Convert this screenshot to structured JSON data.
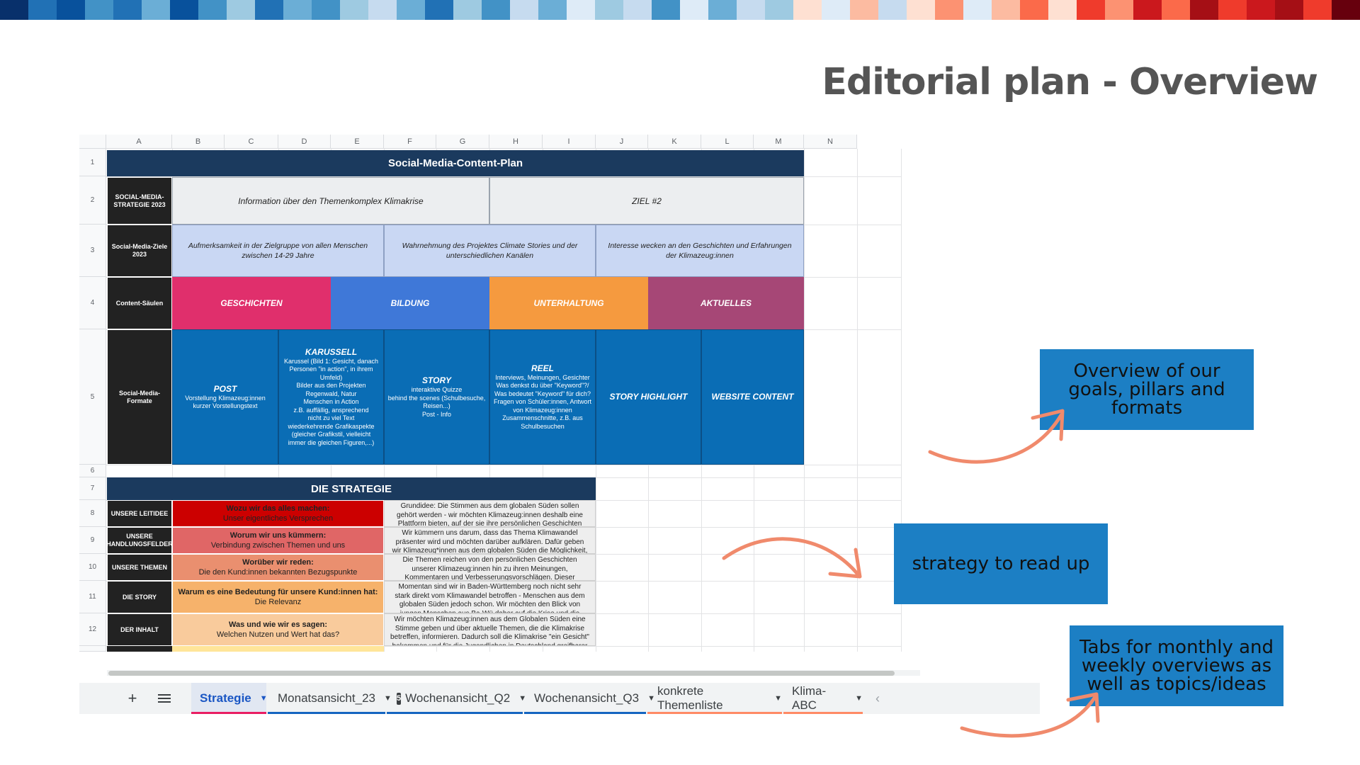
{
  "slide": {
    "title": "Editorial plan - Overview"
  },
  "stripe_colors": [
    "#08306b",
    "#2171b5",
    "#08519c",
    "#4292c6",
    "#2171b5",
    "#6baed6",
    "#08519c",
    "#4292c6",
    "#9ecae1",
    "#2171b5",
    "#6baed6",
    "#4292c6",
    "#9ecae1",
    "#c6dbef",
    "#6baed6",
    "#2171b5",
    "#9ecae1",
    "#4292c6",
    "#c6dbef",
    "#6baed6",
    "#deebf7",
    "#9ecae1",
    "#c6dbef",
    "#4292c6",
    "#deebf7",
    "#6baed6",
    "#c6dbef",
    "#9ecae1",
    "#fee0d2",
    "#deebf7",
    "#fcbba1",
    "#c6dbef",
    "#fee0d2",
    "#fc9272",
    "#deebf7",
    "#fcbba1",
    "#fb6a4a",
    "#fee0d2",
    "#ef3b2c",
    "#fc9272",
    "#cb181d",
    "#fb6a4a",
    "#a50f15",
    "#ef3b2c",
    "#cb181d",
    "#a50f15",
    "#ef3b2c",
    "#67000d"
  ],
  "sheet": {
    "columns": [
      "A",
      "B",
      "C",
      "D",
      "E",
      "F",
      "G",
      "H",
      "I",
      "J",
      "K",
      "L",
      "M",
      "N"
    ],
    "rows": [
      "1",
      "2",
      "3",
      "4",
      "5",
      "6",
      "7",
      "8",
      "9",
      "10",
      "11",
      "12"
    ],
    "header": "Social-Media-Content-Plan",
    "row2": {
      "label": "SOCIAL-MEDIA-STRATEGIE 2023",
      "goal1": "Information über den Themenkomplex Klimakrise",
      "goal2": "ZIEL #2"
    },
    "row3": {
      "label": "Social-Media-Ziele 2023",
      "z1": "Aufmerksamkeit in der Zielgruppe von allen Menschen zwischen 14-29 Jahre",
      "z2": "Wahrnehmung des Projektes Climate Stories und der unterschiedlichen Kanälen",
      "z3": "Interesse wecken an den Geschichten und Erfahrungen der Klimazeug:innen"
    },
    "row4": {
      "label": "Content-Säulen",
      "pillars": [
        {
          "label": "GESCHICHTEN",
          "color": "#e02f6c"
        },
        {
          "label": "BILDUNG",
          "color": "#3f78d8"
        },
        {
          "label": "UNTERHALTUNG",
          "color": "#f59a3f"
        },
        {
          "label": "AKTUELLES",
          "color": "#a64776"
        }
      ]
    },
    "row5": {
      "label": "Social-Media- Formate",
      "formats": [
        {
          "title": "POST",
          "desc": "Vorstellung Klimazeug:innen\nkurzer Vorstellungstext"
        },
        {
          "title": "KARUSSELL",
          "desc": "Karussel (Bild 1: Gesicht, danach Personen \"in action\", in ihrem Umfeld)\nBilder aus den Projekten\nRegenwald, Natur\nMenschen in Action\nz.B. auffällig, ansprechend\nnicht zu viel Text\nwiederkehrende Grafikaspekte (gleicher Grafikstil, vielleicht immer die gleichen Figuren,...)"
        },
        {
          "title": "STORY",
          "desc": "interaktive Quizze\nbehind the scenes (Schulbesuche, Reisen...)\nPost - Info"
        },
        {
          "title": "REEL",
          "desc": "Interviews, Meinungen, Gesichter\nWas denkst du über \"Keyword\"?/ Was bedeutet \"Keyword\" für dich?\nFragen von Schüler:innen, Antwort von Klimazeug:innen\nZusammenschnitte, z.B. aus Schulbesuchen"
        },
        {
          "title": "STORY HIGHLIGHT",
          "desc": ""
        },
        {
          "title": "WEBSITE CONTENT",
          "desc": ""
        }
      ]
    },
    "strategy_header": "DIE STRATEGIE",
    "strategy_rows": [
      {
        "label": "UNSERE LEITIDEE",
        "q": "Wozu wir das alles machen:",
        "a": "Unser eigentliches Versprechen",
        "color": "#cc0000",
        "text": "Grundidee: Die Stimmen aus dem globalen Süden sollen gehört werden - wir möchten Klimazeug:innen deshalb eine Plattform bieten, auf der sie ihre persönlichen Geschichten erzählen können."
      },
      {
        "label": "UNSERE HANDLUNGSFELDER",
        "q": "Worum wir uns kümmern:",
        "a": "Verbindung zwischen Themen und uns",
        "color": "#e06666",
        "text": "Wir kümmern uns darum, dass das Thema Klimawandel präsenter wird und möchten darüber aufklären. Dafür geben wir Klimazeug*innen aus dem globalen Süden die Möglichkeit, ihre Erfahrungen zu erzählen und aufzuklären. Somit können wir das wichtige"
      },
      {
        "label": "UNSERE THEMEN",
        "q": "Worüber wir reden:",
        "a": "Die den Kund:innen bekannten Bezugspunkte",
        "color": "#ea8f6f",
        "text": "Die Themen reichen von den persönlichen Geschichten unserer Klimazeug:innen hin zu ihren Meinungen, Kommentaren und Verbesserungsvorschlägen. Dieser persönliche Themenkomplex wird mit seriösen und informativen Inhalten zum Thema Klimawandel"
      },
      {
        "label": "DIE STORY",
        "q": "Warum es eine Bedeutung für unsere Kund:innen hat:",
        "a": "Die Relevanz",
        "color": "#f6b26b",
        "text": "Momentan sind wir in Baden-Württemberg noch nicht sehr stark direkt vom Klimawandel betroffen - Menschen aus dem globalen Süden jedoch schon. Wir möchten den Blick von jungen Menschen aus Ba-Wü daher auf die Krise und die betroffenen Personen lenken."
      },
      {
        "label": "DER INHALT",
        "q": "Was und wie wir es sagen:",
        "a": "Welchen Nutzen und Wert hat das?",
        "color": "#f9cb9c",
        "text": "Wir möchten Klimazeug:innen aus dem Globalen Süden eine Stimme geben und über aktuelle Themen, die die Klimakrise betreffen, informieren. Dadurch soll die Klimakrise \"ein Gesicht\" bekommen und für die Jugendlichen in Deutschland greifbarer werden"
      }
    ]
  },
  "tabs": [
    {
      "label": "Strategie",
      "active": true,
      "color": "#e91e63"
    },
    {
      "label": "Monatsansicht_23",
      "active": false,
      "color": "#1565c0"
    },
    {
      "label": "Wochenansicht_Q2",
      "active": false,
      "color": "#1565c0",
      "badge": "5"
    },
    {
      "label": "Wochenansicht_Q3",
      "active": false,
      "color": "#1565c0"
    },
    {
      "label": "konkrete Themenliste",
      "active": false,
      "color": "#ff8a65"
    },
    {
      "label": "Klima-ABC",
      "active": false,
      "color": "#ff8a65"
    }
  ],
  "callouts": {
    "overview": "Overview of our goals, pillars and formats",
    "strategy": "strategy to read up",
    "tabs": "Tabs for monthly and weekly overviews as well as topics/ideas"
  },
  "icons": {
    "add": "plus-icon",
    "all_sheets": "menu-icon",
    "dropdown": "triangle-down-icon",
    "scroll_left": "chevron-left-icon"
  }
}
